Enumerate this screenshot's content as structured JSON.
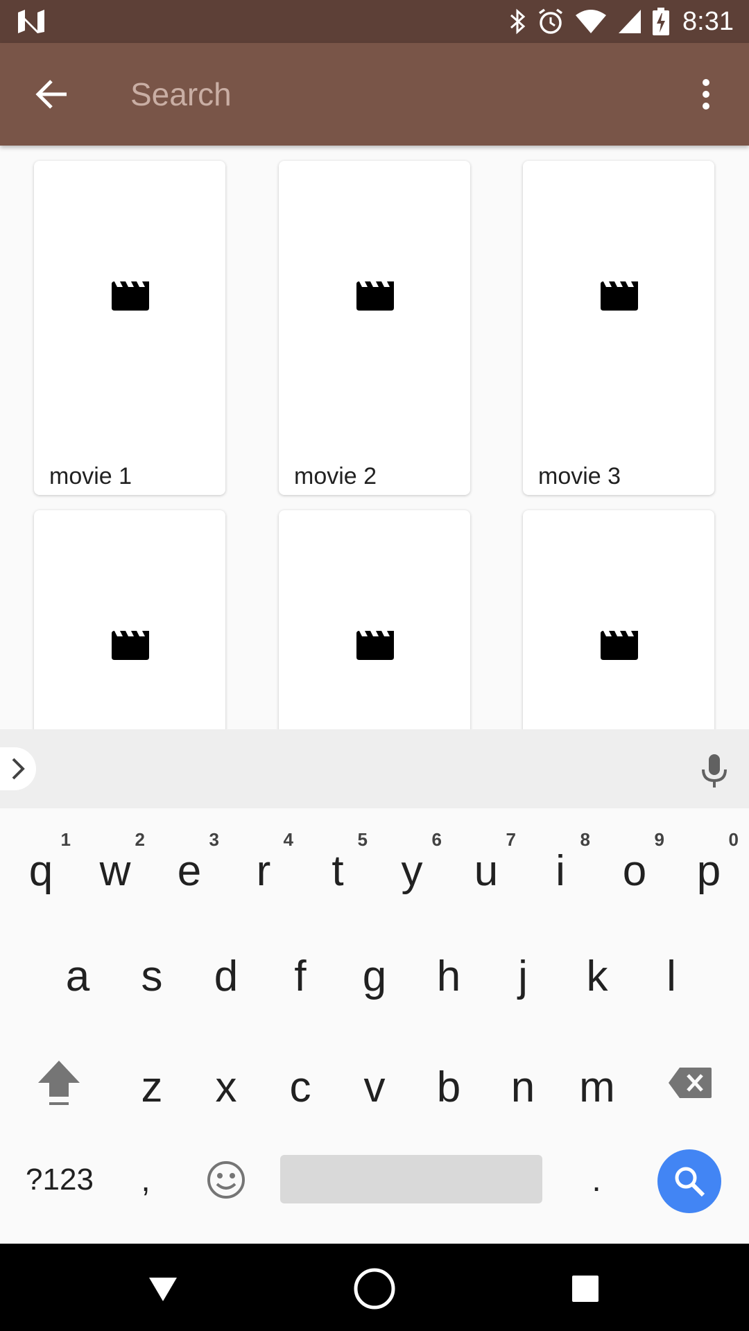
{
  "status_bar": {
    "time": "8:31",
    "icons": [
      "notification-n-icon",
      "bluetooth-icon",
      "alarm-icon",
      "wifi-icon",
      "signal-icon",
      "battery-charging-icon"
    ],
    "background": "#5d4037"
  },
  "app_bar": {
    "background": "#795548",
    "search_placeholder": "Search",
    "icons": [
      "back-arrow-icon",
      "overflow-menu-icon"
    ]
  },
  "grid": {
    "cards": [
      {
        "title": "movie 1",
        "icon": "movie-clapper-icon"
      },
      {
        "title": "movie 2",
        "icon": "movie-clapper-icon"
      },
      {
        "title": "movie 3",
        "icon": "movie-clapper-icon"
      },
      {
        "title": "",
        "icon": "movie-clapper-icon"
      },
      {
        "title": "",
        "icon": "movie-clapper-icon"
      },
      {
        "title": "",
        "icon": "movie-clapper-icon"
      }
    ]
  },
  "keyboard": {
    "row1": [
      {
        "ch": "q",
        "num": "1"
      },
      {
        "ch": "w",
        "num": "2"
      },
      {
        "ch": "e",
        "num": "3"
      },
      {
        "ch": "r",
        "num": "4"
      },
      {
        "ch": "t",
        "num": "5"
      },
      {
        "ch": "y",
        "num": "6"
      },
      {
        "ch": "u",
        "num": "7"
      },
      {
        "ch": "i",
        "num": "8"
      },
      {
        "ch": "o",
        "num": "9"
      },
      {
        "ch": "p",
        "num": "0"
      }
    ],
    "row2": [
      "a",
      "s",
      "d",
      "f",
      "g",
      "h",
      "j",
      "k",
      "l"
    ],
    "row3": [
      "z",
      "x",
      "c",
      "v",
      "b",
      "n",
      "m"
    ],
    "symbols_label": "?123",
    "comma": ",",
    "period": ".",
    "accent": "#4285f4"
  },
  "nav_bar": {
    "icons": [
      "back-triangle-icon",
      "home-circle-icon",
      "recents-square-icon"
    ]
  }
}
